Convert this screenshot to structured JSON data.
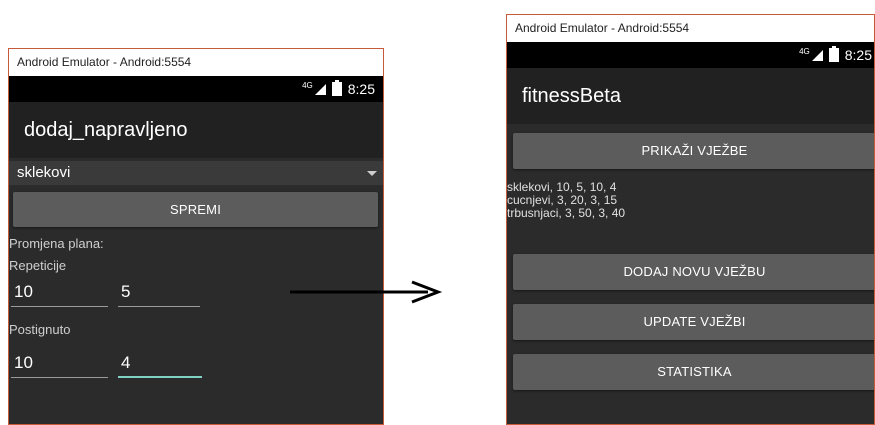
{
  "left_window": {
    "title": "Android Emulator - Android:5554",
    "status": {
      "network": "4G",
      "time": "8:25"
    },
    "app_title": "dodaj_napravljeno",
    "spinner_value": "sklekovi",
    "save_button": "SPREMI",
    "plan_change_label": "Promjena plana:",
    "reps_label": "Repeticije",
    "reps_values": [
      "10",
      "5"
    ],
    "achieved_label": "Postignuto",
    "achieved_values": [
      "10",
      "4"
    ]
  },
  "right_window": {
    "title": "Android Emulator - Android:5554",
    "status": {
      "network": "4G",
      "time": "8:25"
    },
    "app_title": "fitnessBeta",
    "show_button": "PRIKAŽI VJEŽBE",
    "workouts": [
      "sklekovi, 10, 5, 10, 4",
      "cucnjevi, 3, 20, 3, 15",
      "trbusnjaci, 3, 50, 3, 40"
    ],
    "add_button": "DODAJ NOVU VJEŽBU",
    "update_button": "UPDATE VJEŽBI",
    "stats_button": "STATISTIKA"
  },
  "colors": {
    "window_border": "#c75b39",
    "screen_bg": "#2b2b2b",
    "button_bg": "#5c5c5c",
    "accent_underline": "#7fd3c2"
  }
}
